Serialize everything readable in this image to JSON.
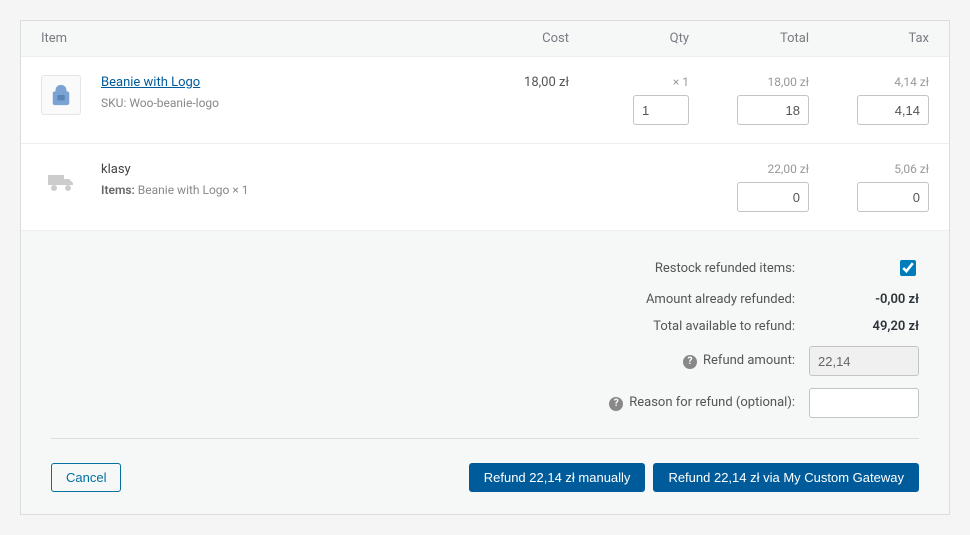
{
  "header": {
    "item": "Item",
    "cost": "Cost",
    "qty": "Qty",
    "total": "Total",
    "tax": "Tax"
  },
  "line1": {
    "name": "Beanie with Logo",
    "sku_label": "SKU:",
    "sku": "Woo-beanie-logo",
    "cost": "18,00 zł",
    "qty_display": "× 1",
    "qty_input": "1",
    "total_display": "18,00 zł",
    "total_input": "18",
    "tax_display": "4,14 zł",
    "tax_input": "4,14"
  },
  "ship": {
    "name": "klasy",
    "items_label": "Items:",
    "items": "Beanie with Logo × 1",
    "total_display": "22,00 zł",
    "total_input": "0",
    "tax_display": "5,06 zł",
    "tax_input": "0"
  },
  "summary": {
    "restock_label": "Restock refunded items:",
    "already_label": "Amount already refunded:",
    "already_value": "-0,00 zł",
    "avail_label": "Total available to refund:",
    "avail_value": "49,20 zł",
    "amount_label": "Refund amount:",
    "amount_value": "22,14",
    "reason_label": "Reason for refund (optional):",
    "reason_value": ""
  },
  "actions": {
    "cancel": "Cancel",
    "manual": "Refund 22,14 zł manually",
    "gateway": "Refund 22,14 zł via My Custom Gateway"
  }
}
